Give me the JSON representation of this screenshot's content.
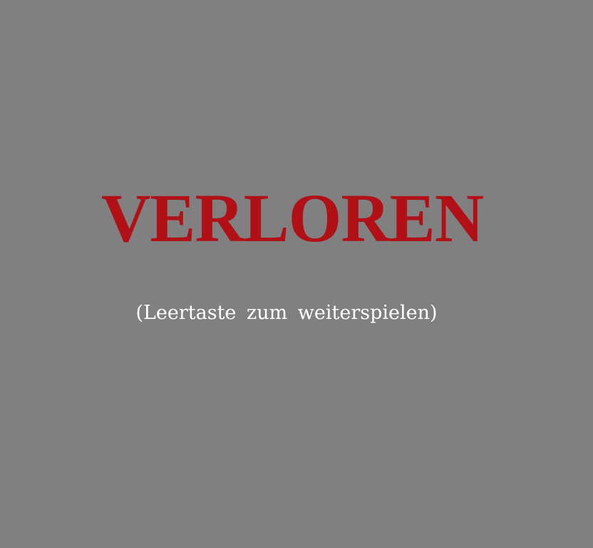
{
  "screen": {
    "background_color": "#808080",
    "title": "VERLOREN",
    "title_color": "#b01016",
    "hint": "(Leertaste zum weiterspielen)",
    "hint_color": "#ffffff"
  }
}
